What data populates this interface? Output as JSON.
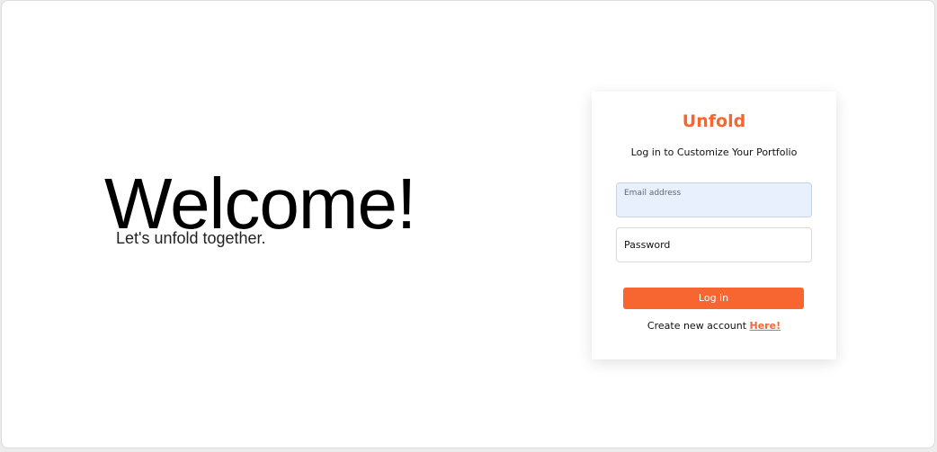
{
  "hero": {
    "title": "Welcome!",
    "subtitle": "Let's unfold together."
  },
  "login_card": {
    "brand": "Unfold",
    "subtitle": "Log in to Customize Your Portfolio",
    "email_field": {
      "placeholder": "Email address",
      "value": ""
    },
    "password_field": {
      "placeholder": "Password",
      "value": ""
    },
    "login_button_label": "Log in",
    "signup_prompt": "Create new account ",
    "signup_link_label": "Here!"
  },
  "colors": {
    "accent": "#f76630",
    "autofill_bg": "#e8f0fe"
  }
}
